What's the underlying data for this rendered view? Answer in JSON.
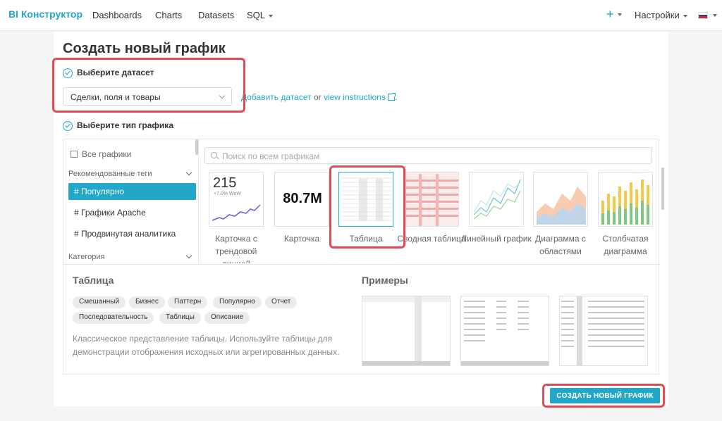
{
  "app": {
    "brand_prefix": "BI",
    "brand_name": "Конструктор"
  },
  "nav": {
    "items": [
      "Dashboards",
      "Charts",
      "Datasets",
      "SQL"
    ],
    "plus": "+",
    "settings": "Настройки"
  },
  "page": {
    "title": "Создать новый график"
  },
  "step1": {
    "label": "Выберите датасет",
    "dataset_value": "Сделки, поля и товары",
    "add_link": "Добавить датасет",
    "or_text": "or",
    "instructions_link": "view instructions",
    "trail": "."
  },
  "step2": {
    "label": "Выберите тип графика"
  },
  "sidebar": {
    "all_charts": "Все графики",
    "recommended_header": "Рекомендованные теги",
    "items": [
      {
        "label": "# Популярно",
        "active": true
      },
      {
        "label": "# Графики Apache",
        "active": false
      },
      {
        "label": "# Продвинутая аналитика",
        "active": false
      }
    ],
    "category_header": "Категория"
  },
  "search": {
    "placeholder": "Поиск по всем графикам"
  },
  "cards": [
    {
      "label": "Карточка с трендовой линией",
      "big": "215",
      "sub": "+7.0% WoW"
    },
    {
      "label": "Карточка",
      "big": "80.7M"
    },
    {
      "label": "Таблица"
    },
    {
      "label": "Сводная таблица"
    },
    {
      "label": "Линейный график"
    },
    {
      "label": "Диаграмма с областями"
    },
    {
      "label": "Столбчатая диаграмма"
    }
  ],
  "selected": {
    "title": "Таблица",
    "tags": [
      "Смешанный",
      "Бизнес",
      "Паттерн",
      "Популярно",
      "Отчет",
      "Последовательность",
      "Таблицы",
      "Описание"
    ],
    "description": "Классическое представление таблицы. Используйте таблицы для демонстрации отображения исходных или агрегированных данных.",
    "examples_title": "Примеры"
  },
  "create_button": "СОЗДАТЬ НОВЫЙ ГРАФИК",
  "colors": {
    "accent": "#20a7c9",
    "highlight": "#e04a55"
  }
}
